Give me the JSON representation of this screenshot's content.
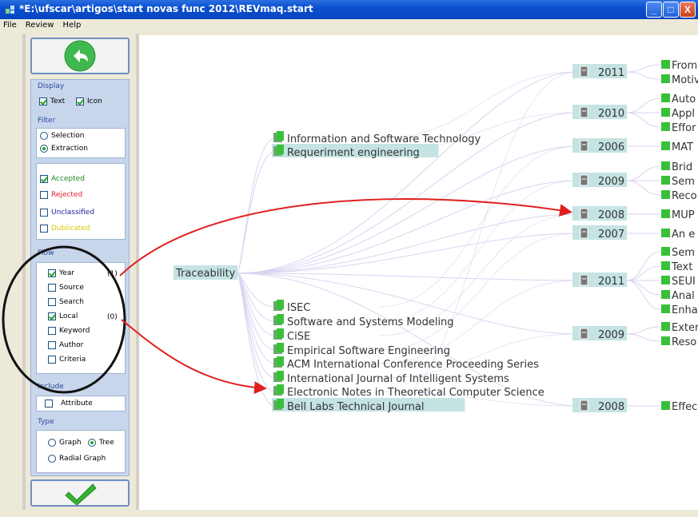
{
  "window": {
    "title": "*E:\\ufscar\\artigos\\start novas func 2012\\REVmaq.start",
    "controls": {
      "minimize": "_",
      "maximize": "□",
      "close": "X"
    }
  },
  "menu": [
    "File",
    "Review",
    "Help"
  ],
  "panel": {
    "display": {
      "label": "Display",
      "text": "Text",
      "text_checked": true,
      "icon": "Icon",
      "icon_checked": true
    },
    "filter": {
      "label": "Filter",
      "modes": [
        {
          "label": "Selection",
          "selected": false
        },
        {
          "label": "Extraction",
          "selected": true
        }
      ],
      "statuses": [
        {
          "label": "Accepted",
          "checked": true,
          "color": "#1f8a1f"
        },
        {
          "label": "Rejected",
          "checked": false,
          "color": "#e0202a"
        },
        {
          "label": "Unclassified",
          "checked": false,
          "color": "#23239c"
        },
        {
          "label": "Dublicated",
          "checked": false,
          "color": "#d8c800"
        }
      ]
    },
    "flow": {
      "label": "Flow",
      "items": [
        {
          "label": "Year",
          "checked": true,
          "order": "(1)"
        },
        {
          "label": "Source",
          "checked": false,
          "order": ""
        },
        {
          "label": "Search",
          "checked": false,
          "order": ""
        },
        {
          "label": "Local",
          "checked": true,
          "order": "(0)"
        },
        {
          "label": "Keyword",
          "checked": false,
          "order": ""
        },
        {
          "label": "Author",
          "checked": false,
          "order": ""
        },
        {
          "label": "Criteria",
          "checked": false,
          "order": ""
        }
      ]
    },
    "include": {
      "label": "Include",
      "attribute": "Attribute",
      "checked": false
    },
    "type": {
      "label": "Type",
      "options": [
        {
          "label": "Graph",
          "selected": false
        },
        {
          "label": "Tree",
          "selected": true
        },
        {
          "label": "Radial Graph",
          "selected": false
        }
      ]
    },
    "back_icon": "back-arrow-icon",
    "ok_icon": "checkmark-icon"
  },
  "tree": {
    "root": "Traceability",
    "sources": [
      "Information and Software Technology",
      "Requeriment engineering",
      "ISEC",
      "Software and Systems Modeling",
      "CiSE",
      "Empirical Software Engineering",
      "ACM International Conference Proceeding Series",
      "International Journal of Intelligent Systems",
      "Electronic Notes in Theoretical Computer Science",
      "Bell Labs Technical Journal"
    ],
    "highlighted_sources": [
      "Requeriment engineering",
      "Bell Labs Technical Journal"
    ],
    "years": [
      {
        "year": "2011",
        "papers": [
          "From",
          "Motiv"
        ]
      },
      {
        "year": "2010",
        "papers": [
          "Auto",
          "Appl",
          "Effor"
        ]
      },
      {
        "year": "2006",
        "papers": [
          "MAT"
        ]
      },
      {
        "year": "2009",
        "papers": [
          "Brid",
          "Sem",
          "Reco"
        ]
      },
      {
        "year": "2008",
        "papers": [
          "MUP"
        ]
      },
      {
        "year": "2007",
        "papers": [
          "An e"
        ]
      },
      {
        "year": "2011",
        "papers": [
          "Sem",
          "Text",
          "SEUI",
          "Anal",
          "Enha"
        ]
      },
      {
        "year": "2009",
        "papers": [
          "Exter",
          "Reso"
        ]
      },
      {
        "year": "2008",
        "papers": [
          "Effec"
        ]
      }
    ]
  },
  "colors": {
    "node_highlight": "#c5e3e3",
    "leaf": "#39c039",
    "edge": "#d8d4f0",
    "annotation": "#e02020",
    "titlebar": "#0a4fd0"
  }
}
